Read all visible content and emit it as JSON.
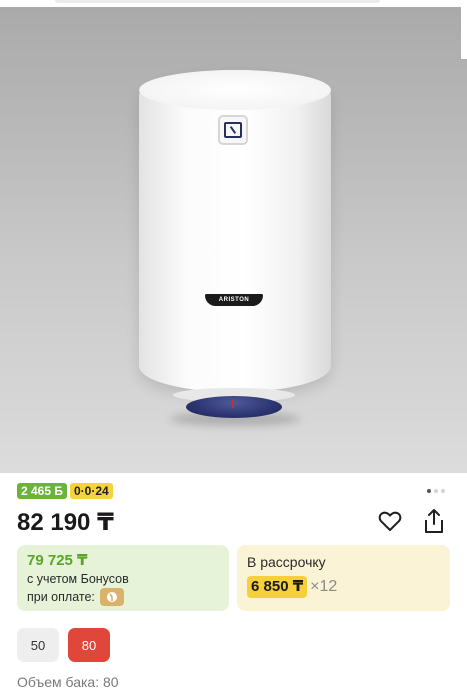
{
  "product": {
    "brand_text": "ARISTON",
    "image_dots": {
      "count": 3,
      "active_index": 0
    }
  },
  "badges": {
    "bonus": "2 465 Б",
    "installment": "0·0·24"
  },
  "price": "82 190 ₸",
  "bonus_card": {
    "amount": "79 725 ₸",
    "line1": "с учетом Бонусов",
    "line2": "при оплате:"
  },
  "installment_card": {
    "title": "В рассрочку",
    "amount": "6 850 ₸",
    "term": "×12"
  },
  "volume_options": [
    {
      "label": "50",
      "selected": false
    },
    {
      "label": "80",
      "selected": true
    }
  ],
  "volume_label": "Объем бака: 80",
  "colors": {
    "accent_red": "#e0463a",
    "bonus_green": "#5aa527",
    "installment_yellow": "#f5d03a"
  }
}
